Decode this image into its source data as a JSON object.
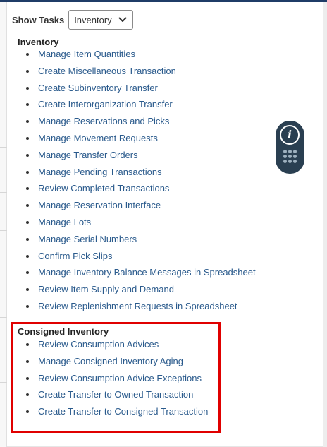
{
  "header": {
    "label": "Show Tasks",
    "select_value": "Inventory"
  },
  "inventory": {
    "heading": "Inventory",
    "items": [
      {
        "label": "Manage Item Quantities"
      },
      {
        "label": "Create Miscellaneous Transaction"
      },
      {
        "label": "Create Subinventory Transfer"
      },
      {
        "label": "Create Interorganization Transfer"
      },
      {
        "label": "Manage Reservations and Picks"
      },
      {
        "label": "Manage Movement Requests"
      },
      {
        "label": "Manage Transfer Orders"
      },
      {
        "label": "Manage Pending Transactions"
      },
      {
        "label": "Review Completed Transactions"
      },
      {
        "label": "Manage Reservation Interface"
      },
      {
        "label": "Manage Lots"
      },
      {
        "label": "Manage Serial Numbers"
      },
      {
        "label": "Confirm Pick Slips"
      },
      {
        "label": "Manage Inventory Balance Messages in Spreadsheet"
      },
      {
        "label": "Review Item Supply and Demand"
      },
      {
        "label": "Review Replenishment Requests in Spreadsheet"
      }
    ]
  },
  "consigned": {
    "heading": "Consigned Inventory",
    "items": [
      {
        "label": "Review Consumption Advices"
      },
      {
        "label": "Manage Consigned Inventory Aging"
      },
      {
        "label": "Review Consumption Advice Exceptions"
      },
      {
        "label": "Create Transfer to Owned Transaction"
      },
      {
        "label": "Create Transfer to Consigned Transaction"
      }
    ]
  },
  "side_panel": {
    "info_icon": "info-icon",
    "grid_icon": "grid-dots-icon"
  },
  "colors": {
    "link": "#2a5a8c",
    "highlight": "#e00000",
    "panel": "#2a3f51",
    "top_strip": "#1f3c67"
  }
}
